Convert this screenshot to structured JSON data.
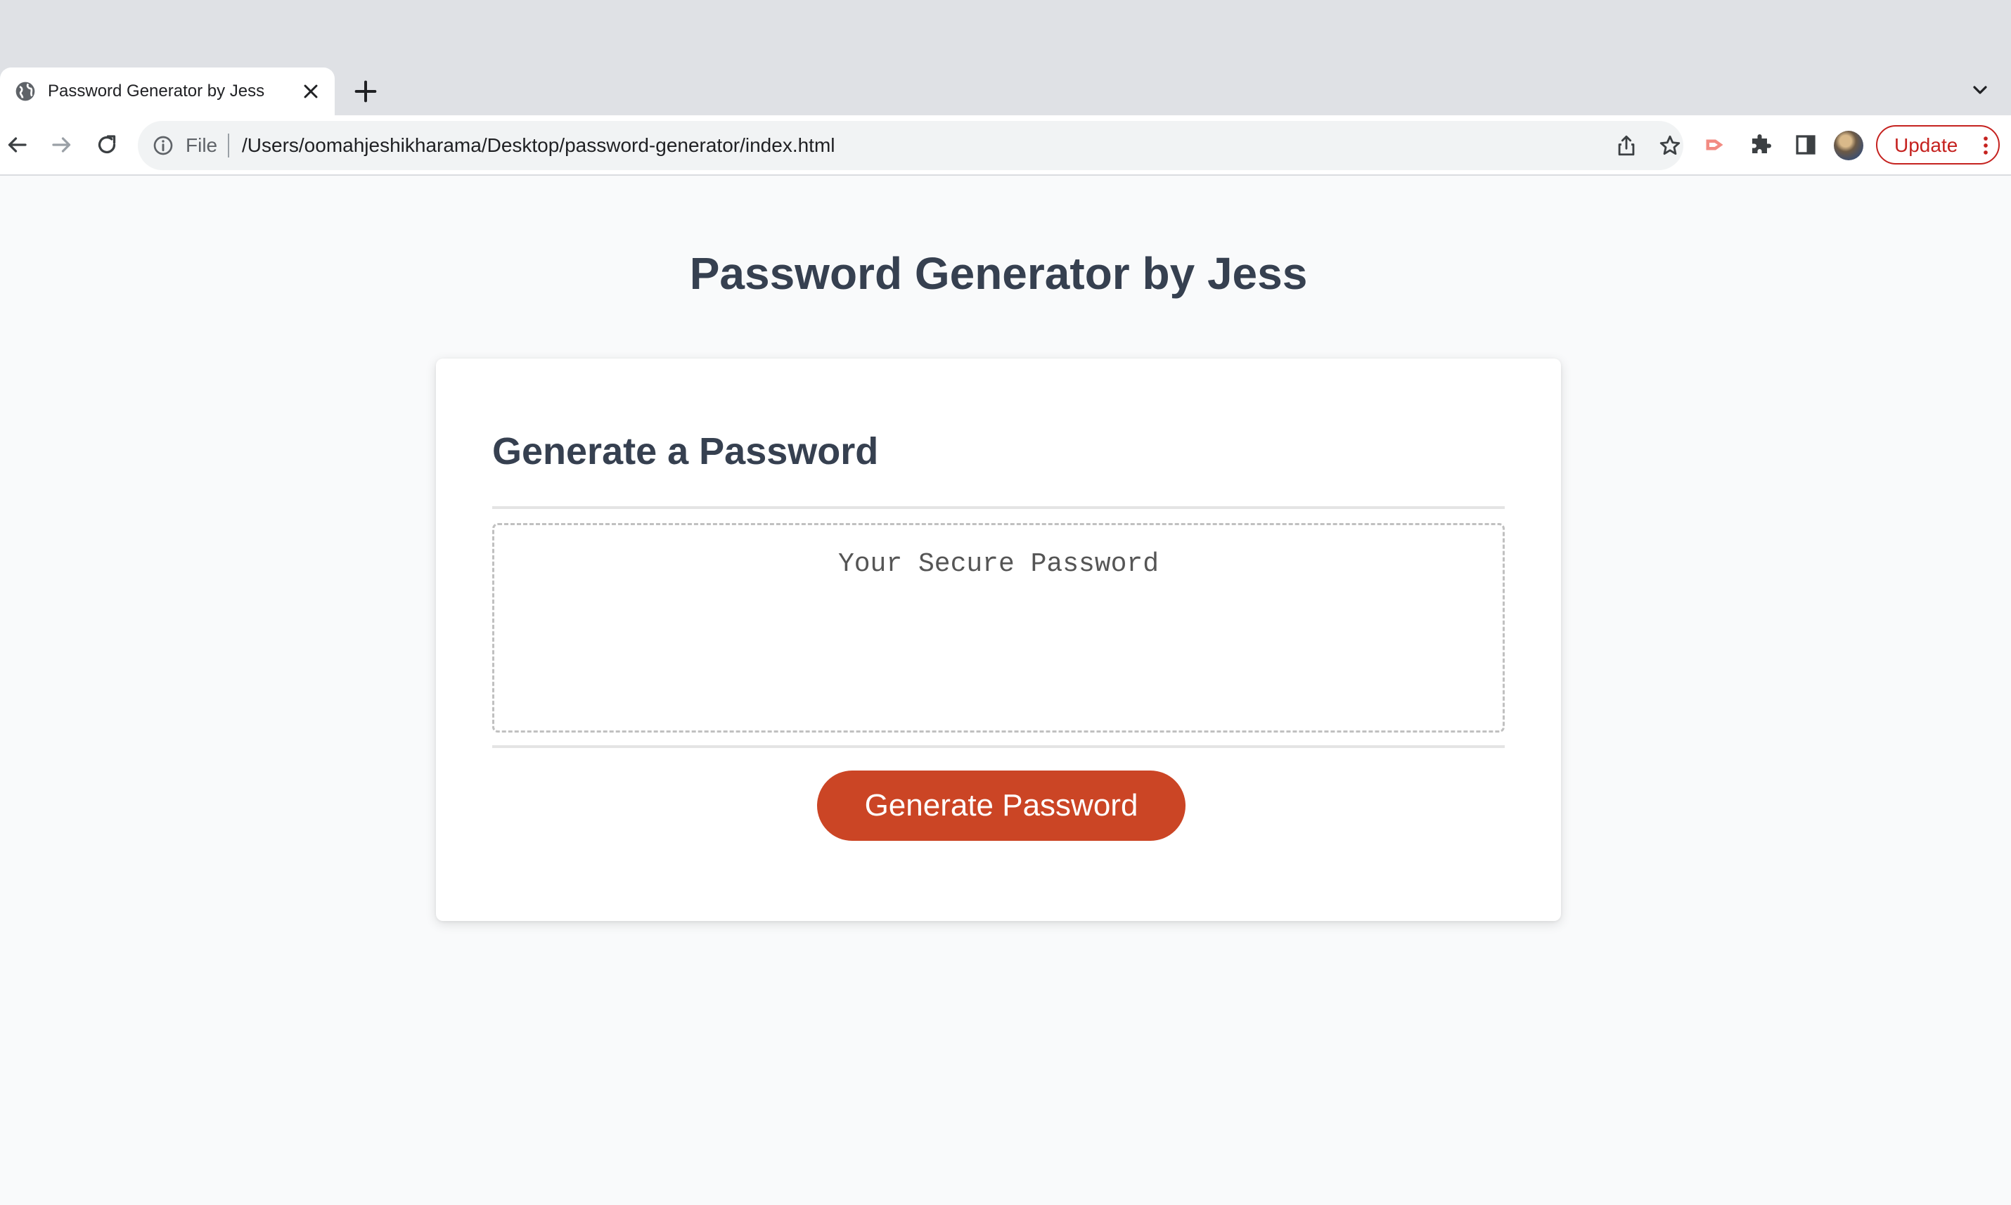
{
  "browser": {
    "tab": {
      "title": "Password Generator by Jess"
    },
    "omnibox": {
      "scheme_label": "File",
      "url": "/Users/oomahjeshikharama/Desktop/password-generator/index.html"
    },
    "update_button_label": "Update",
    "accent_color": "#c5221f",
    "icons": [
      "globe-icon",
      "close-icon",
      "plus-icon",
      "chevron-down-icon",
      "back-arrow-icon",
      "forward-arrow-icon",
      "reload-icon",
      "info-icon",
      "share-icon",
      "star-icon",
      "cast-extension-icon",
      "puzzle-icon",
      "side-panel-icon",
      "profile-avatar",
      "more-vert-icon"
    ]
  },
  "page": {
    "title": "Password Generator by Jess",
    "card": {
      "title": "Generate a Password",
      "password_placeholder": "Your Secure Password",
      "password_value": "",
      "generate_button_label": "Generate Password"
    },
    "colors": {
      "heading": "#364050",
      "button": "#cb4525",
      "background": "#f9fafb"
    }
  }
}
